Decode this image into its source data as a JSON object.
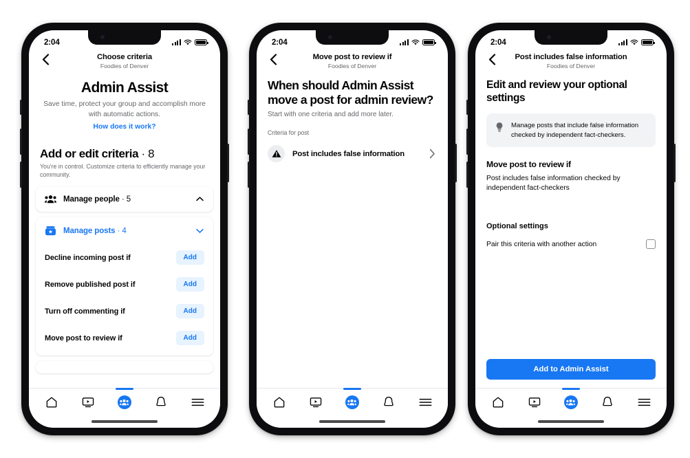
{
  "status_bar": {
    "time": "2:04",
    "signal_icon": "cellular-signal-icon",
    "wifi_icon": "wifi-icon",
    "battery_icon": "battery-icon"
  },
  "tab_bar": {
    "items": [
      {
        "name": "home",
        "icon": "home-icon",
        "active": false
      },
      {
        "name": "watch",
        "icon": "video-icon",
        "active": false
      },
      {
        "name": "groups",
        "icon": "groups-icon",
        "active": true
      },
      {
        "name": "notifications",
        "icon": "bell-icon",
        "active": false
      },
      {
        "name": "menu",
        "icon": "hamburger-menu-icon",
        "active": false
      }
    ]
  },
  "colors": {
    "brand_blue": "#1877F2",
    "add_button_bg": "#E7F3FF",
    "tip_box_bg": "#F2F3F5",
    "secondary_text": "#65676B",
    "primary_text": "#050505"
  },
  "screen1": {
    "nav": {
      "back_icon": "chevron-left-icon",
      "title": "Choose criteria",
      "subtitle": "Foodies of Denver"
    },
    "hero": {
      "title": "Admin Assist",
      "description": "Save time, protect your group and accomplish more with automatic actions.",
      "link": "How does it work?"
    },
    "section": {
      "title": "Add or edit criteria",
      "count": "· 8",
      "description": "You're in control. Customize criteria to efficiently manage your community."
    },
    "cards": [
      {
        "icon": "manage-people-icon",
        "title": "Manage people",
        "count": "· 5",
        "expanded": false,
        "chevron": "chevron-up-icon",
        "rows": []
      },
      {
        "icon": "manage-posts-icon",
        "title": "Manage posts",
        "count": "· 4",
        "expanded": true,
        "chevron": "chevron-down-icon",
        "rows": [
          {
            "label": "Decline incoming post if",
            "action": "Add"
          },
          {
            "label": "Remove published post if",
            "action": "Add"
          },
          {
            "label": "Turn off commenting if",
            "action": "Add"
          },
          {
            "label": "Move post to review if",
            "action": "Add"
          }
        ]
      }
    ]
  },
  "screen2": {
    "nav": {
      "back_icon": "chevron-left-icon",
      "title": "Move post to review if",
      "subtitle": "Foodies of Denver"
    },
    "heading": "When should Admin Assist move a post for admin review?",
    "subheading": "Start with one criteria and add more later.",
    "group_label": "Criteria for post",
    "criteria": [
      {
        "icon": "warning-triangle-icon",
        "label": "Post includes false information",
        "chevron": "chevron-right-icon"
      }
    ]
  },
  "screen3": {
    "nav": {
      "back_icon": "chevron-left-icon",
      "title": "Post includes false information",
      "subtitle": "Foodies of Denver"
    },
    "heading": "Edit and review your optional settings",
    "tip": {
      "icon": "lightbulb-icon",
      "text": "Manage posts that include false information checked by independent fact-checkers."
    },
    "section_title": "Move post to review if",
    "section_body": "Post includes false information checked by independent fact-checkers",
    "optional_title": "Optional settings",
    "optional_row": {
      "label": "Pair this criteria with another action",
      "checked": false
    },
    "cta_label": "Add to Admin Assist"
  }
}
